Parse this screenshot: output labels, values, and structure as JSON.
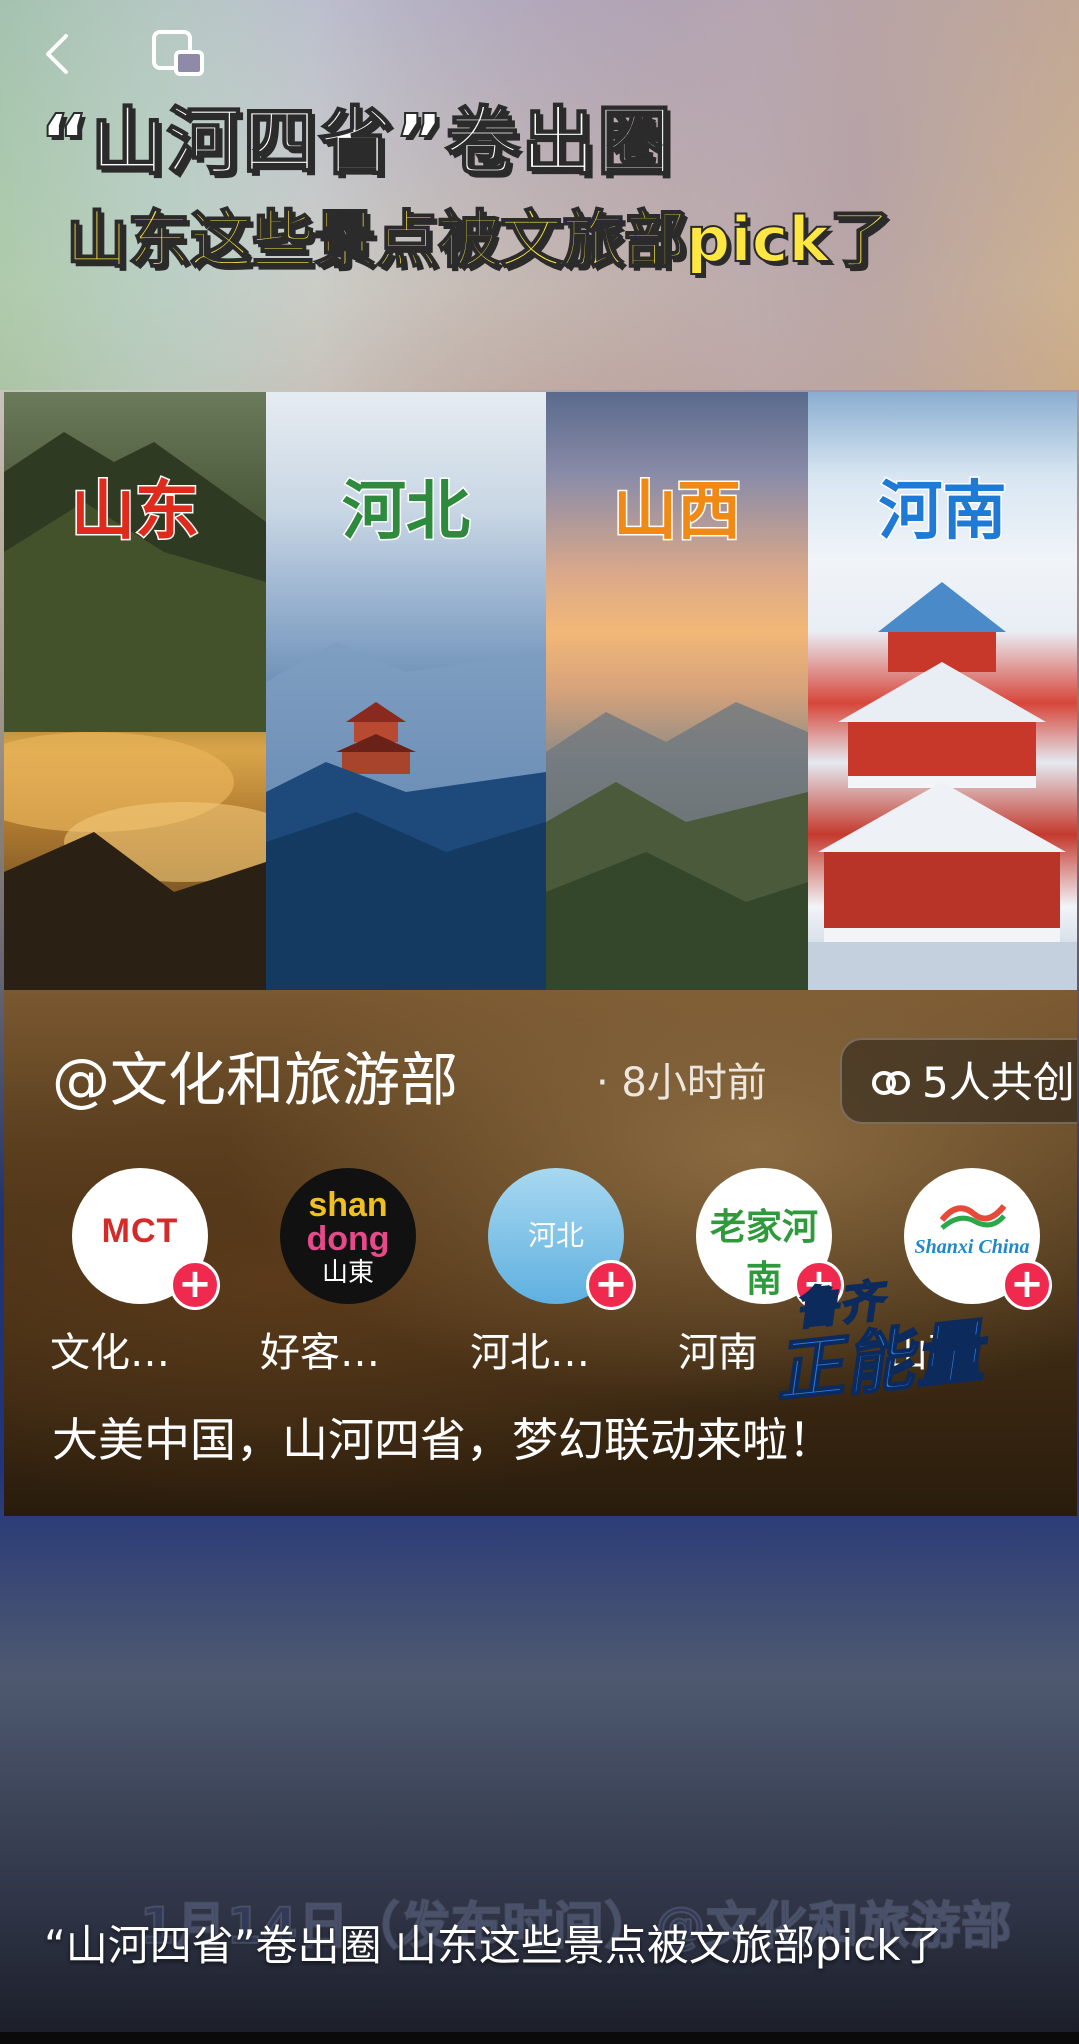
{
  "headline": "“山河四省”卷出圈",
  "subhead": "山东这些景点被文旅部pick了",
  "panels": [
    {
      "label": "山东"
    },
    {
      "label": "河北"
    },
    {
      "label": "山西"
    },
    {
      "label": "河南"
    }
  ],
  "post": {
    "author": "@文化和旅游部",
    "time": "· 8小时前",
    "coop": "5人共创",
    "avatars": [
      {
        "name": "文化…",
        "logo_text": "MCT"
      },
      {
        "name": "好客…",
        "logo_line1": "shan",
        "logo_line2": "dong",
        "logo_line3": "山東"
      },
      {
        "name": "河北…",
        "logo_text": "河北"
      },
      {
        "name": "河南",
        "logo_text": "老家河南"
      },
      {
        "name": "山西",
        "logo_text": "Shanxi China"
      }
    ],
    "caption": "大美中国，山河四省，梦幻联动来啦！",
    "stamp_top": "鲁齐",
    "stamp_main": "正能量"
  },
  "watermark_date": "1月14日（发布时间）@文化和旅游部",
  "bottom_caption": "“山河四省”卷出圈 山东这些景点被文旅部pick了",
  "colors": {
    "subhead": "#ffe640",
    "shandong_label": "#e02a1c",
    "hebei_label": "#2e8a3c",
    "shanxi_label": "#f08a14",
    "henan_label": "#1f7ad6",
    "follow_plus": "#f0294f"
  }
}
